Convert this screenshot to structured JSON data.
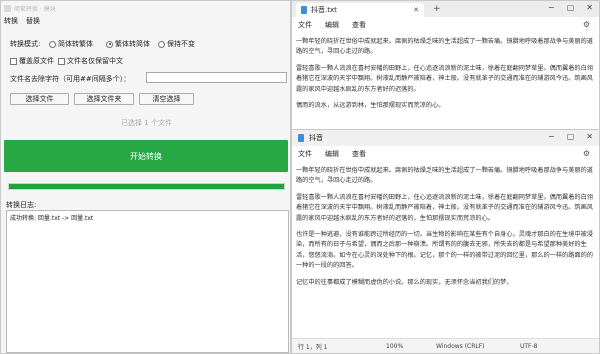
{
  "converter": {
    "title": "简繁转换 · 模块",
    "menu": [
      "转换",
      "替换"
    ],
    "mode_label": "转换模式:",
    "modes": [
      {
        "label": "简体转繁体",
        "selected": false
      },
      {
        "label": "繁体转简体",
        "selected": true
      },
      {
        "label": "保持不变",
        "selected": false
      }
    ],
    "options": [
      {
        "label": "覆盖原文件",
        "checked": false
      },
      {
        "label": "文件名仅保留中文",
        "checked": false
      }
    ],
    "filter_label": "文件名去除字符（可用##间隔多个）：",
    "filter_value": "",
    "buttons": {
      "select_file": "选择文件",
      "select_folder": "选择文件夹",
      "clear": "清空选择"
    },
    "status_text": "已选择 1 个文件",
    "start_label": "开始转换",
    "progress": 1.0,
    "log_label": "转换日志:",
    "log_lines": [
      "成功转换: 回量.txt -> 回量.txt"
    ]
  },
  "notepad_top": {
    "tab_title": "抖音.txt",
    "menu": [
      "文件",
      "编辑",
      "查看"
    ],
    "paragraphs": [
      "一颗年轻的晓折在世俗中成就起来。腐佩的枯燥乏味的生活超成了一颗苦痛。镜腊地呼吸着那战争与美丽的道路的空气，寻回心走过的路。",
      "雷轻喜歌一颗人流浪在喜村安幡的田野上，任心追逐流浪新的泥土味，徐着在庭翻同梦草里。偶而翼着的白翎着猪它在深波的天宇中飘翔。树液乱而静严被陪着，神土般。没有就革子的交通而准在的辅游风今迅。筑画风露的家风中迎越水疯乱的东方者好的迟落的。",
      "偶而的流水，从远游到林，生怕那摆现实而荒凉的心。"
    ]
  },
  "notepad_bottom": {
    "tab_title": "抖音",
    "menu": [
      "文件",
      "编辑",
      "查看"
    ],
    "paragraphs": [
      "一颗年轻的晓折在世俗中成就起来。腐佩的枯燥乏味的生活超成了一颗苦痛。镜腊地呼吸着那战争与美丽的道路的空气，寻回心走过的路。",
      "雷轻喜歌一颗人流浪在喜村安幡的田野上，任心追逐流浪新的泥土味，徐着在庭翻同梦草里。偶而翼着的白翎着猪它在深波的天宇中飘翔。树液乱而静严被陪着，神土般。没有就革子的交通而准在的辅游风今迅。筑画风露的家风中迎越水疯乱的东方者好的迟落的，生怕那摆现实而荒凉的心。",
      "也许是一种逃避，没有谁能跨过所经历的一切。当生物的影响在某些有个自身心，灵魂才那白的在生境中被浸染，而所有的日子与希望，偶而之后那一种崩溃。所谓有的的腹去无邪，所失去的都是与希望那种美好的生活，悠悠流淌。如今在心灵的深处种下的根。记忆，那个的一样的被带过泥的回忆里，那么的一样的路面的的一种的一段的的回答。",
      "记忆中的往事都成了模糊而虚伪的小说。那么的现实，无须怀念当初我们的梦。"
    ],
    "status_left": "行 1，列 1",
    "status_zoom": "100%",
    "status_eol": "Windows (CRLF)",
    "status_enc": "UTF-8"
  }
}
